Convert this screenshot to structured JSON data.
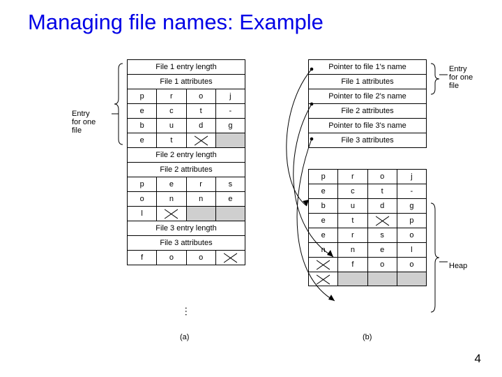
{
  "title": "Managing file names: Example",
  "page_number": "4",
  "labels": {
    "left_bracket": "Entry\nfor one\nfile",
    "right_bracket_top": "Entry\nfor one\nfile",
    "right_bracket_bottom": "Heap",
    "caption_a": "(a)",
    "caption_b": "(b)"
  },
  "col_a": {
    "rows": [
      {
        "type": "span",
        "text": "File 1 entry length"
      },
      {
        "type": "span",
        "text": "File 1 attributes"
      },
      {
        "type": "cells",
        "cells": [
          "p",
          "r",
          "o",
          "j"
        ]
      },
      {
        "type": "cells",
        "cells": [
          "e",
          "c",
          "t",
          "-"
        ]
      },
      {
        "type": "cells",
        "cells": [
          "b",
          "u",
          "d",
          "g"
        ]
      },
      {
        "type": "cells",
        "cells": [
          "e",
          "t",
          "X",
          ""
        ],
        "flags": [
          "",
          "",
          "x",
          "grey"
        ]
      },
      {
        "type": "span",
        "text": "File 2 entry length"
      },
      {
        "type": "span",
        "text": "File 2 attributes"
      },
      {
        "type": "cells",
        "cells": [
          "p",
          "e",
          "r",
          "s"
        ]
      },
      {
        "type": "cells",
        "cells": [
          "o",
          "n",
          "n",
          "e"
        ]
      },
      {
        "type": "cells",
        "cells": [
          "l",
          "X",
          "",
          ""
        ],
        "flags": [
          "",
          "x",
          "grey",
          "grey"
        ]
      },
      {
        "type": "span",
        "text": "File 3 entry length"
      },
      {
        "type": "span",
        "text": "File 3 attributes"
      },
      {
        "type": "cells",
        "cells": [
          "f",
          "o",
          "o",
          "X"
        ],
        "flags": [
          "",
          "",
          "",
          "x"
        ]
      }
    ]
  },
  "col_b": {
    "top_rows": [
      {
        "type": "span",
        "text": "Pointer to file 1's name"
      },
      {
        "type": "span",
        "text": "File 1 attributes"
      },
      {
        "type": "span",
        "text": "Pointer to file 2's name"
      },
      {
        "type": "span",
        "text": "File 2 attributes"
      },
      {
        "type": "span",
        "text": "Pointer to file 3's name"
      },
      {
        "type": "span",
        "text": "File 3 attributes"
      }
    ],
    "heap_rows": [
      {
        "type": "cells",
        "cells": [
          "p",
          "r",
          "o",
          "j"
        ]
      },
      {
        "type": "cells",
        "cells": [
          "e",
          "c",
          "t",
          "-"
        ]
      },
      {
        "type": "cells",
        "cells": [
          "b",
          "u",
          "d",
          "g"
        ]
      },
      {
        "type": "cells",
        "cells": [
          "e",
          "t",
          "X",
          "p"
        ],
        "flags": [
          "",
          "",
          "x",
          ""
        ]
      },
      {
        "type": "cells",
        "cells": [
          "e",
          "r",
          "s",
          "o"
        ]
      },
      {
        "type": "cells",
        "cells": [
          "n",
          "n",
          "e",
          "l"
        ]
      },
      {
        "type": "cells",
        "cells": [
          "X",
          "f",
          "o",
          "o"
        ],
        "flags": [
          "x",
          "",
          "",
          ""
        ]
      },
      {
        "type": "cells",
        "cells": [
          "X",
          "",
          "",
          ""
        ],
        "flags": [
          "x",
          "grey",
          "grey",
          "grey"
        ]
      }
    ]
  }
}
